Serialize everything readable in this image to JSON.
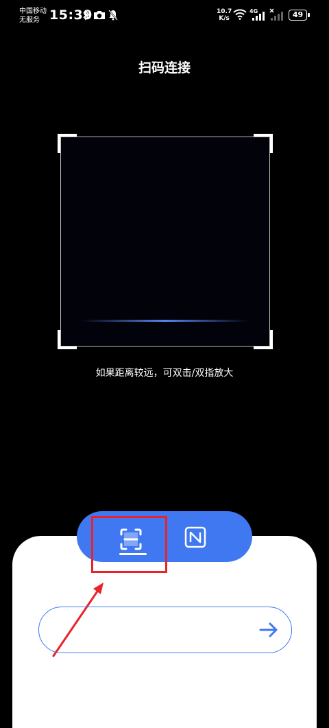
{
  "status_bar": {
    "carrier_line1": "中国移动",
    "carrier_line2": "无服务",
    "time": "15:39",
    "speed_value": "10.7",
    "speed_unit": "K/s",
    "network_type": "4G",
    "battery": "49"
  },
  "header": {
    "title": "扫码连接"
  },
  "scanner": {
    "hint": "如果距离较远，可双击/双指放大"
  },
  "mode_switch": {
    "items": [
      {
        "name": "scan-qr-code",
        "selected": true
      },
      {
        "name": "nfc",
        "selected": false
      }
    ]
  },
  "connect": {
    "input_value": "",
    "submit_icon": "arrow-right-icon"
  },
  "colors": {
    "accent": "#3f78f0",
    "annotation": "#e8232a",
    "background": "#000000",
    "panel": "#ffffff"
  }
}
